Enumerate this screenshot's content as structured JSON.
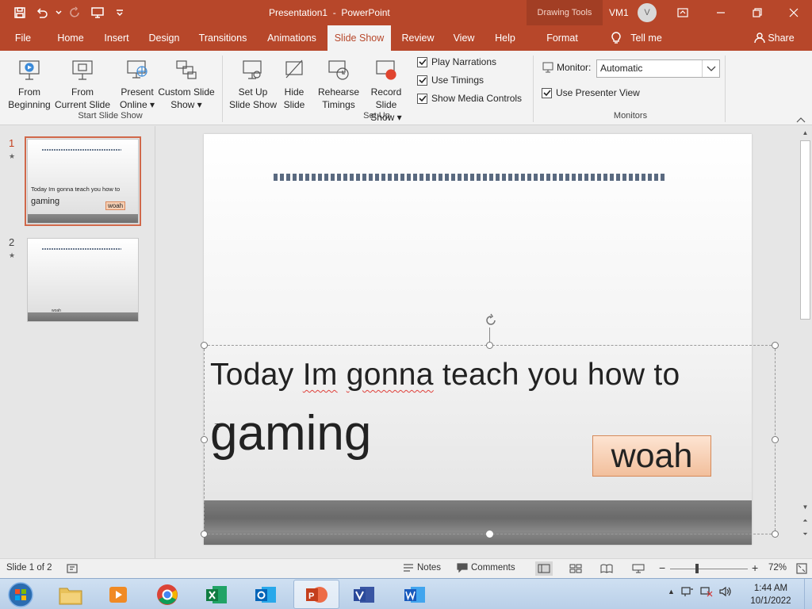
{
  "titlebar": {
    "doc_title": "Presentation1  -  PowerPoint",
    "context_label": "Drawing Tools",
    "user_name": "VM1",
    "avatar_initial": "V"
  },
  "tabs": [
    {
      "label": "File"
    },
    {
      "label": "Home"
    },
    {
      "label": "Insert"
    },
    {
      "label": "Design"
    },
    {
      "label": "Transitions"
    },
    {
      "label": "Animations"
    },
    {
      "label": "Slide Show"
    },
    {
      "label": "Review"
    },
    {
      "label": "View"
    },
    {
      "label": "Help"
    },
    {
      "label": "Format"
    },
    {
      "label": "Tell me"
    },
    {
      "label": "Share"
    }
  ],
  "ribbon": {
    "from_beginning": [
      "From",
      "Beginning"
    ],
    "from_current": [
      "From",
      "Current Slide"
    ],
    "present_online": [
      "Present",
      "Online"
    ],
    "custom_show": [
      "Custom Slide",
      "Show"
    ],
    "group_start": "Start Slide Show",
    "set_up": [
      "Set Up",
      "Slide Show"
    ],
    "hide_slide": [
      "Hide",
      "Slide"
    ],
    "rehearse": [
      "Rehearse",
      "Timings"
    ],
    "record": [
      "Record Slide",
      "Show"
    ],
    "play_narrations": "Play Narrations",
    "use_timings": "Use Timings",
    "show_media": "Show Media Controls",
    "group_setup": "Set Up",
    "monitor_label": "Monitor:",
    "monitor_value": "Automatic",
    "presenter_view": "Use Presenter View",
    "group_monitors": "Monitors"
  },
  "thumbnails": [
    {
      "number": "1",
      "line1": "Today Im gonna teach you how to",
      "line2": "gaming",
      "badge": "woah"
    },
    {
      "number": "2",
      "small": "woah"
    }
  ],
  "slide": {
    "line1_part1": "Today ",
    "line1_misspelled1": "Im",
    "line1_space": " ",
    "line1_misspelled2": "gonna",
    "line1_part2": " teach you how to",
    "line2": "gaming",
    "badge": "woah"
  },
  "statusbar": {
    "slide_info": "Slide 1 of 2",
    "notes": "Notes",
    "comments": "Comments",
    "zoom": "72%"
  },
  "taskbar": {
    "time": "1:44 AM",
    "date": "10/1/2022"
  },
  "colors": {
    "accent": "#b7472a",
    "selection_outline": "#d0684a"
  }
}
